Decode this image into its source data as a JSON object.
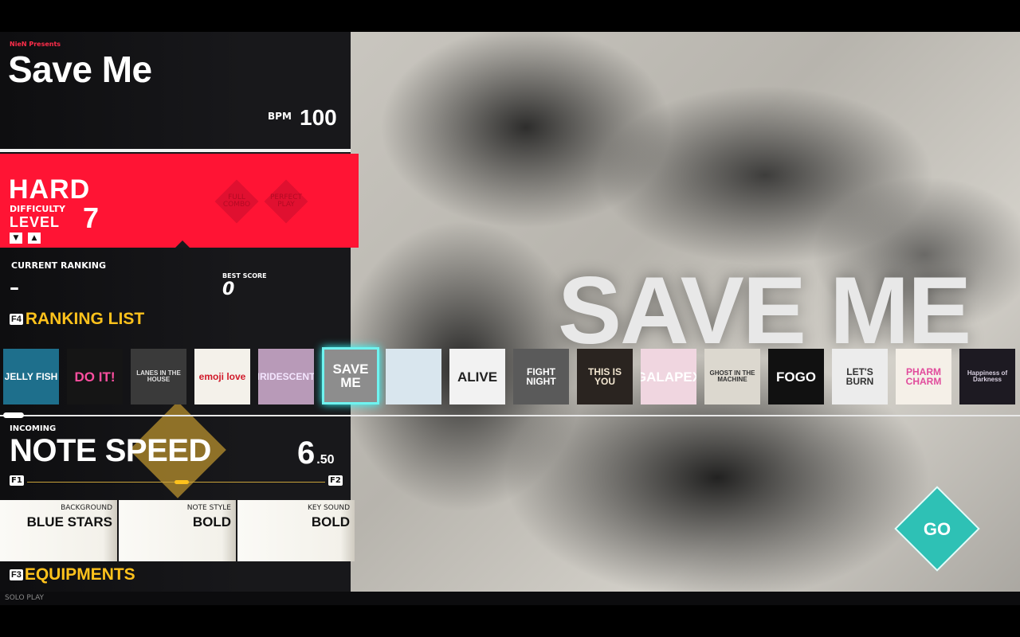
{
  "song": {
    "presenter": "NieN Presents",
    "title": "Save Me",
    "bpm_label": "BPM",
    "bpm": "100",
    "bg_title": "SAVE ME"
  },
  "difficulty": {
    "name": "HARD",
    "label": "DIFFICULTY",
    "level_word": "LEVEL",
    "level": "7",
    "down_arrow": "▼",
    "up_arrow": "▲",
    "badges": [
      "FULL COMBO",
      "PERFECT PLAY"
    ]
  },
  "ranking": {
    "current_label": "CURRENT RANKING",
    "current_value": "–",
    "best_label": "BEST SCORE",
    "best_value": "0",
    "list_key": "F4",
    "list_label": "RANKING LIST"
  },
  "albums": [
    {
      "title": "JELLY FISH",
      "bg": "#1e6f8c",
      "fg": "#ffffff"
    },
    {
      "title": "DO IT!",
      "bg": "#151515",
      "fg": "#ff4fa0"
    },
    {
      "title": "LANES IN THE HOUSE",
      "bg": "#3a3a3a",
      "fg": "#e0e0e0"
    },
    {
      "title": "emoji love",
      "bg": "#f4f1ea",
      "fg": "#d11a2a"
    },
    {
      "title": "IRIDESCENT",
      "bg": "#b89ab8",
      "fg": "#f4e6ff"
    },
    {
      "title": "SAVE ME",
      "bg": "#8d8d8d",
      "fg": "#ffffff",
      "selected": true
    },
    {
      "title": "",
      "bg": "#d9e6ee",
      "fg": "#1b6fd6"
    },
    {
      "title": "ALIVE",
      "bg": "#f2f2f2",
      "fg": "#222222"
    },
    {
      "title": "FIGHT NIGHT",
      "bg": "#5a5a5a",
      "fg": "#ffffff"
    },
    {
      "title": "THIS IS YOU",
      "bg": "#2a2420",
      "fg": "#f2e6d0"
    },
    {
      "title": "GALAPEX",
      "bg": "#f0d6e0",
      "fg": "#ffffff"
    },
    {
      "title": "GHOST IN THE MACHINE",
      "bg": "#dcd8cf",
      "fg": "#333333"
    },
    {
      "title": "FOGO",
      "bg": "#111111",
      "fg": "#ffffff"
    },
    {
      "title": "LET'S BURN",
      "bg": "#ececec",
      "fg": "#333333"
    },
    {
      "title": "PHARM CHARM",
      "bg": "#f5f0e8",
      "fg": "#e14b9c"
    },
    {
      "title": "Happiness of Darkness",
      "bg": "#1d1a22",
      "fg": "#d8d0e0"
    }
  ],
  "note_speed": {
    "incoming": "INCOMING",
    "title": "NOTE SPEED",
    "value_int": "6",
    "value_dec": ".50",
    "dec_key": "F1",
    "inc_key": "F2",
    "fraction": 0.52
  },
  "equipment": [
    {
      "label": "BACKGROUND",
      "value": "BLUE STARS"
    },
    {
      "label": "NOTE STYLE",
      "value": "BOLD"
    },
    {
      "label": "KEY SOUND",
      "value": "BOLD"
    }
  ],
  "equip_key": "F3",
  "equip_label": "EQUIPMENTS",
  "mode": "SOLO PLAY",
  "go_label": "GO",
  "colors": {
    "accent_red": "#ff1434",
    "accent_gold": "#ffc21c",
    "go_teal": "#2ec1b5",
    "select_cyan": "#6ff3f0"
  }
}
